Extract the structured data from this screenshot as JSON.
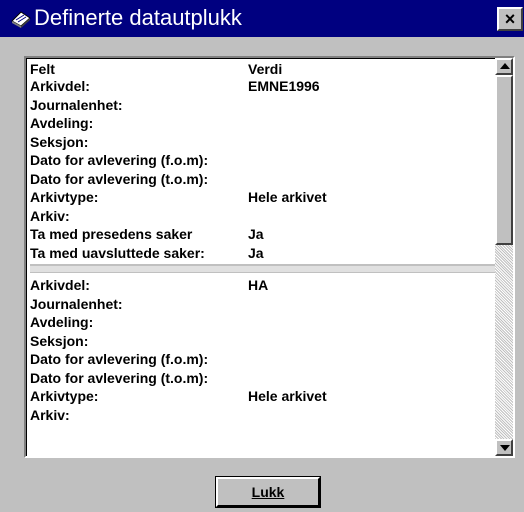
{
  "window": {
    "title": "Definerte datautplukk",
    "close_label": "×",
    "icon": "dialog-app-icon"
  },
  "table": {
    "headers": {
      "felt": "Felt",
      "verdi": "Verdi"
    },
    "records": [
      {
        "rows": [
          {
            "felt": "Arkivdel:",
            "verdi": "EMNE1996"
          },
          {
            "felt": "Journalenhet:",
            "verdi": ""
          },
          {
            "felt": "Avdeling:",
            "verdi": ""
          },
          {
            "felt": "Seksjon:",
            "verdi": ""
          },
          {
            "felt": "Dato for avlevering (f.o.m):",
            "verdi": ""
          },
          {
            "felt": "Dato for avlevering (t.o.m):",
            "verdi": ""
          },
          {
            "felt": "Arkivtype:",
            "verdi": "Hele arkivet"
          },
          {
            "felt": "Arkiv:",
            "verdi": ""
          },
          {
            "felt": "Ta med presedens saker",
            "verdi": "Ja"
          },
          {
            "felt": "Ta med uavsluttede saker:",
            "verdi": "Ja"
          }
        ]
      },
      {
        "rows": [
          {
            "felt": "Arkivdel:",
            "verdi": "HA"
          },
          {
            "felt": "Journalenhet:",
            "verdi": ""
          },
          {
            "felt": "Avdeling:",
            "verdi": ""
          },
          {
            "felt": "Seksjon:",
            "verdi": ""
          },
          {
            "felt": "Dato for avlevering (f.o.m):",
            "verdi": ""
          },
          {
            "felt": "Dato for avlevering (t.o.m):",
            "verdi": ""
          },
          {
            "felt": "Arkivtype:",
            "verdi": "Hele arkivet"
          },
          {
            "felt": "Arkiv:",
            "verdi": ""
          }
        ]
      }
    ]
  },
  "buttons": {
    "lukk_label": "Lukk"
  },
  "scrollbar": {
    "up_icon": "arrow-up-icon",
    "down_icon": "arrow-down-icon"
  },
  "colors": {
    "titlebar": "#000080",
    "face": "#c0c0c0"
  }
}
